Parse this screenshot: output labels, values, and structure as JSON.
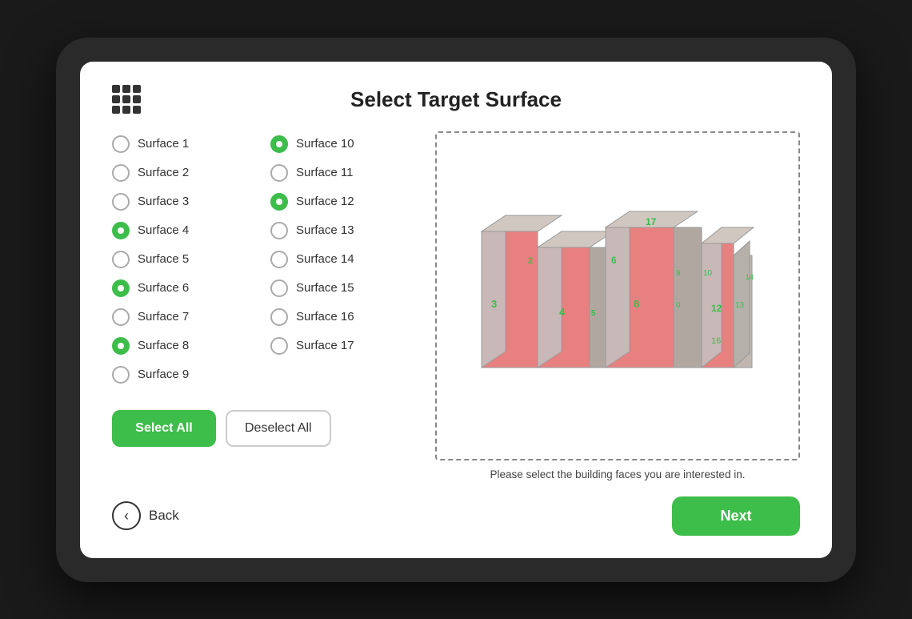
{
  "page": {
    "title": "Select Target Surface",
    "hint": "Please select the building faces you are interested in."
  },
  "header": {
    "grid_icon": "grid-icon"
  },
  "surfaces": [
    {
      "id": 1,
      "label": "Surface 1",
      "selected": false
    },
    {
      "id": 2,
      "label": "Surface 2",
      "selected": false
    },
    {
      "id": 3,
      "label": "Surface 3",
      "selected": false
    },
    {
      "id": 4,
      "label": "Surface 4",
      "selected": true
    },
    {
      "id": 5,
      "label": "Surface 5",
      "selected": false
    },
    {
      "id": 6,
      "label": "Surface 6",
      "selected": true
    },
    {
      "id": 7,
      "label": "Surface 7",
      "selected": false
    },
    {
      "id": 8,
      "label": "Surface 8",
      "selected": true
    },
    {
      "id": 9,
      "label": "Surface 9",
      "selected": false
    },
    {
      "id": 10,
      "label": "Surface 10",
      "selected": true
    },
    {
      "id": 11,
      "label": "Surface 11",
      "selected": false
    },
    {
      "id": 12,
      "label": "Surface 12",
      "selected": true
    },
    {
      "id": 13,
      "label": "Surface 13",
      "selected": false
    },
    {
      "id": 14,
      "label": "Surface 14",
      "selected": false
    },
    {
      "id": 15,
      "label": "Surface 15",
      "selected": false
    },
    {
      "id": 16,
      "label": "Surface 16",
      "selected": false
    },
    {
      "id": 17,
      "label": "Surface 17",
      "selected": false
    }
  ],
  "buttons": {
    "select_all": "Select All",
    "deselect_all": "Deselect All",
    "back": "Back",
    "next": "Next"
  },
  "colors": {
    "green": "#3dbd4a",
    "pink_surface": "#e88080",
    "gray_surface": "#b0a8a0",
    "label_green": "#3dbd4a"
  }
}
